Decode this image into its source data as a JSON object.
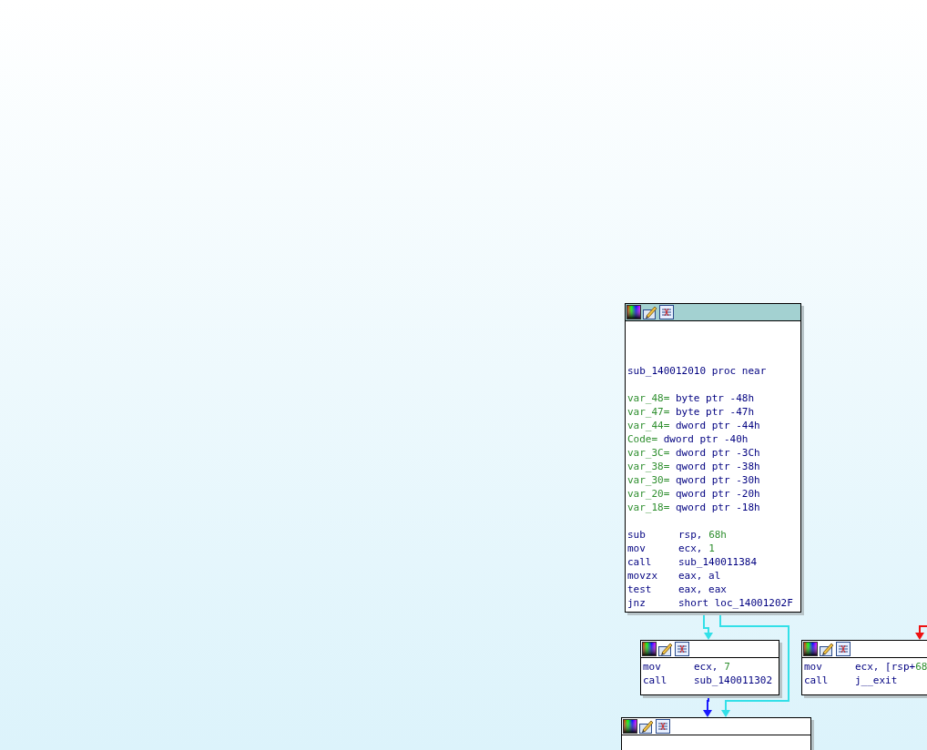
{
  "nodes": [
    {
      "header_selected": true,
      "lines": [
        {
          "kind": "blank"
        },
        {
          "kind": "blank"
        },
        {
          "kind": "blank"
        },
        {
          "kind": "label",
          "text": "sub_140012010 proc near"
        },
        {
          "kind": "blank"
        },
        {
          "kind": "var",
          "name": "var_48=",
          "text": " byte ptr -48h"
        },
        {
          "kind": "var",
          "name": "var_47=",
          "text": " byte ptr -47h"
        },
        {
          "kind": "var",
          "name": "var_44=",
          "text": " dword ptr -44h"
        },
        {
          "kind": "var",
          "name": "Code=",
          "text": " dword ptr -40h"
        },
        {
          "kind": "var",
          "name": "var_3C=",
          "text": " dword ptr -3Ch"
        },
        {
          "kind": "var",
          "name": "var_38=",
          "text": " qword ptr -38h"
        },
        {
          "kind": "var",
          "name": "var_30=",
          "text": " qword ptr -30h"
        },
        {
          "kind": "var",
          "name": "var_20=",
          "text": " qword ptr -20h"
        },
        {
          "kind": "var",
          "name": "var_18=",
          "text": " qword ptr -18h"
        },
        {
          "kind": "blank"
        },
        {
          "kind": "insn",
          "mnemonic": "sub",
          "operands": [
            {
              "kind": "plain",
              "text": "rsp, "
            },
            {
              "kind": "number",
              "text": "68h"
            }
          ]
        },
        {
          "kind": "insn",
          "mnemonic": "mov",
          "operands": [
            {
              "kind": "plain",
              "text": "ecx, "
            },
            {
              "kind": "number",
              "text": "1"
            }
          ]
        },
        {
          "kind": "insn",
          "mnemonic": "call",
          "operands": [
            {
              "kind": "plain",
              "text": "sub_140011384"
            }
          ]
        },
        {
          "kind": "insn",
          "mnemonic": "movzx",
          "operands": [
            {
              "kind": "plain",
              "text": "eax, al"
            }
          ]
        },
        {
          "kind": "insn",
          "mnemonic": "test",
          "operands": [
            {
              "kind": "plain",
              "text": "eax, eax"
            }
          ]
        },
        {
          "kind": "insn",
          "mnemonic": "jnz",
          "operands": [
            {
              "kind": "plain",
              "text": "short loc_14001202F"
            }
          ]
        }
      ]
    },
    {
      "header_selected": false,
      "lines": [
        {
          "kind": "insn",
          "mnemonic": "mov",
          "operands": [
            {
              "kind": "plain",
              "text": "ecx, "
            },
            {
              "kind": "number",
              "text": "7"
            }
          ]
        },
        {
          "kind": "insn",
          "mnemonic": "call",
          "operands": [
            {
              "kind": "plain",
              "text": "sub_140011302"
            }
          ]
        }
      ]
    },
    {
      "header_selected": false,
      "lines": [
        {
          "kind": "insn",
          "mnemonic": "mov",
          "operands": [
            {
              "kind": "plain",
              "text": "ecx, [rsp+"
            },
            {
              "kind": "number",
              "text": "68"
            }
          ]
        },
        {
          "kind": "insn",
          "mnemonic": "call",
          "operands": [
            {
              "kind": "plain",
              "text": "j__exit"
            }
          ]
        }
      ]
    },
    {
      "header_selected": false
    }
  ],
  "edges": [
    {
      "color": "#33e0e8"
    },
    {
      "color": "#33e0e8"
    },
    {
      "color": "#1a1aff"
    },
    {
      "color": "#ee1111"
    }
  ]
}
